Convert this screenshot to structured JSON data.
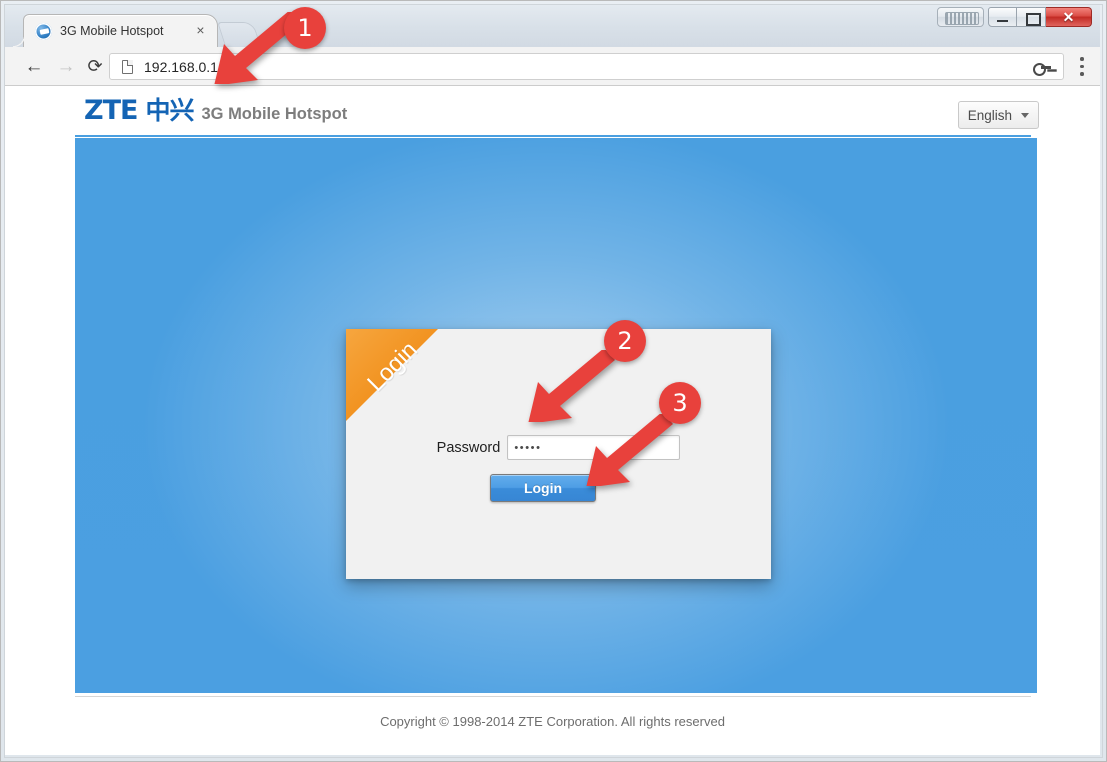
{
  "browser": {
    "tab": {
      "title": "3G Mobile Hotspot",
      "close_label": "×",
      "favicon": "globe-icon"
    },
    "new_tab_label": "",
    "toolbar": {
      "back_icon": "←",
      "forward_icon": "→",
      "reload_icon": "⟳",
      "url": "192.168.0.1",
      "page_icon": "page-icon",
      "key_icon": "key-icon",
      "menu_icon": "kebab-menu-icon"
    },
    "window_controls": {
      "minimize": "minimize-icon",
      "maximize": "maximize-icon",
      "close": "close-icon",
      "restore_group": "window-group-icon"
    }
  },
  "page": {
    "brand": {
      "zte": "ZTE",
      "cn": "中兴",
      "product": "3G Mobile Hotspot"
    },
    "language": {
      "selected": "English",
      "caret": "chevron-down-icon"
    },
    "card": {
      "ribbon_label": "Login",
      "password_label": "Password",
      "password_value": "•••••",
      "password_placeholder": "",
      "login_button": "Login"
    },
    "footer": "Copyright © 1998-2014 ZTE Corporation. All rights reserved"
  },
  "annotations": [
    {
      "number": "1",
      "target": "address-bar"
    },
    {
      "number": "2",
      "target": "password-field"
    },
    {
      "number": "3",
      "target": "login-button"
    }
  ],
  "colors": {
    "stage_blue": "#4a9fe0",
    "brand_blue": "#1464b4",
    "ribbon_orange": "#f08a1e",
    "annotation_red": "#e8413c",
    "button_blue": "#4e9ee5"
  }
}
